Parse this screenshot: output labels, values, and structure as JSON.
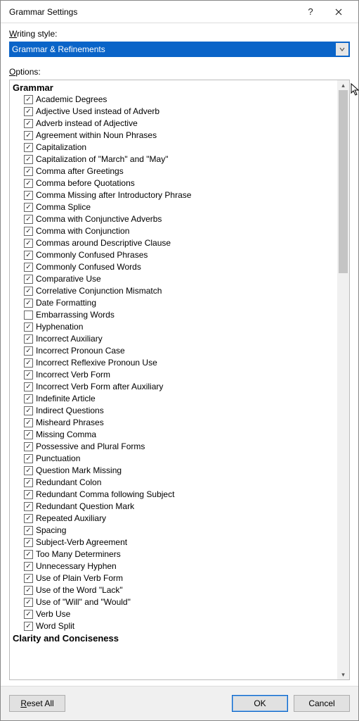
{
  "window": {
    "title": "Grammar Settings"
  },
  "labels": {
    "writing_style": "Writing style:",
    "options": "Options:"
  },
  "dropdown": {
    "selected": "Grammar & Refinements"
  },
  "groups": [
    {
      "name": "Grammar",
      "items": [
        {
          "label": "Academic Degrees",
          "checked": true
        },
        {
          "label": "Adjective Used instead of Adverb",
          "checked": true
        },
        {
          "label": "Adverb instead of Adjective",
          "checked": true
        },
        {
          "label": "Agreement within Noun Phrases",
          "checked": true
        },
        {
          "label": "Capitalization",
          "checked": true
        },
        {
          "label": "Capitalization of \"March\" and \"May\"",
          "checked": true
        },
        {
          "label": "Comma after Greetings",
          "checked": true
        },
        {
          "label": "Comma before Quotations",
          "checked": true
        },
        {
          "label": "Comma Missing after Introductory Phrase",
          "checked": true
        },
        {
          "label": "Comma Splice",
          "checked": true
        },
        {
          "label": "Comma with Conjunctive Adverbs",
          "checked": true
        },
        {
          "label": "Comma with Conjunction",
          "checked": true
        },
        {
          "label": "Commas around Descriptive Clause",
          "checked": true
        },
        {
          "label": "Commonly Confused Phrases",
          "checked": true
        },
        {
          "label": "Commonly Confused Words",
          "checked": true
        },
        {
          "label": "Comparative Use",
          "checked": true
        },
        {
          "label": "Correlative Conjunction Mismatch",
          "checked": true
        },
        {
          "label": "Date Formatting",
          "checked": true
        },
        {
          "label": "Embarrassing Words",
          "checked": false
        },
        {
          "label": "Hyphenation",
          "checked": true
        },
        {
          "label": "Incorrect Auxiliary",
          "checked": true
        },
        {
          "label": "Incorrect Pronoun Case",
          "checked": true
        },
        {
          "label": "Incorrect Reflexive Pronoun Use",
          "checked": true
        },
        {
          "label": "Incorrect Verb Form",
          "checked": true
        },
        {
          "label": "Incorrect Verb Form after Auxiliary",
          "checked": true
        },
        {
          "label": "Indefinite Article",
          "checked": true
        },
        {
          "label": "Indirect Questions",
          "checked": true
        },
        {
          "label": "Misheard Phrases",
          "checked": true
        },
        {
          "label": "Missing Comma",
          "checked": true
        },
        {
          "label": "Possessive and Plural Forms",
          "checked": true
        },
        {
          "label": "Punctuation",
          "checked": true
        },
        {
          "label": "Question Mark Missing",
          "checked": true
        },
        {
          "label": "Redundant Colon",
          "checked": true
        },
        {
          "label": "Redundant Comma following Subject",
          "checked": true
        },
        {
          "label": "Redundant Question Mark",
          "checked": true
        },
        {
          "label": "Repeated Auxiliary",
          "checked": true
        },
        {
          "label": "Spacing",
          "checked": true
        },
        {
          "label": "Subject-Verb Agreement",
          "checked": true
        },
        {
          "label": "Too Many Determiners",
          "checked": true
        },
        {
          "label": "Unnecessary Hyphen",
          "checked": true
        },
        {
          "label": "Use of Plain Verb Form",
          "checked": true
        },
        {
          "label": "Use of the Word \"Lack\"",
          "checked": true
        },
        {
          "label": "Use of \"Will\" and \"Would\"",
          "checked": true
        },
        {
          "label": "Verb Use",
          "checked": true
        },
        {
          "label": "Word Split",
          "checked": true
        }
      ]
    },
    {
      "name": "Clarity and Conciseness",
      "items": []
    }
  ],
  "buttons": {
    "reset": "Reset All",
    "ok": "OK",
    "cancel": "Cancel"
  }
}
